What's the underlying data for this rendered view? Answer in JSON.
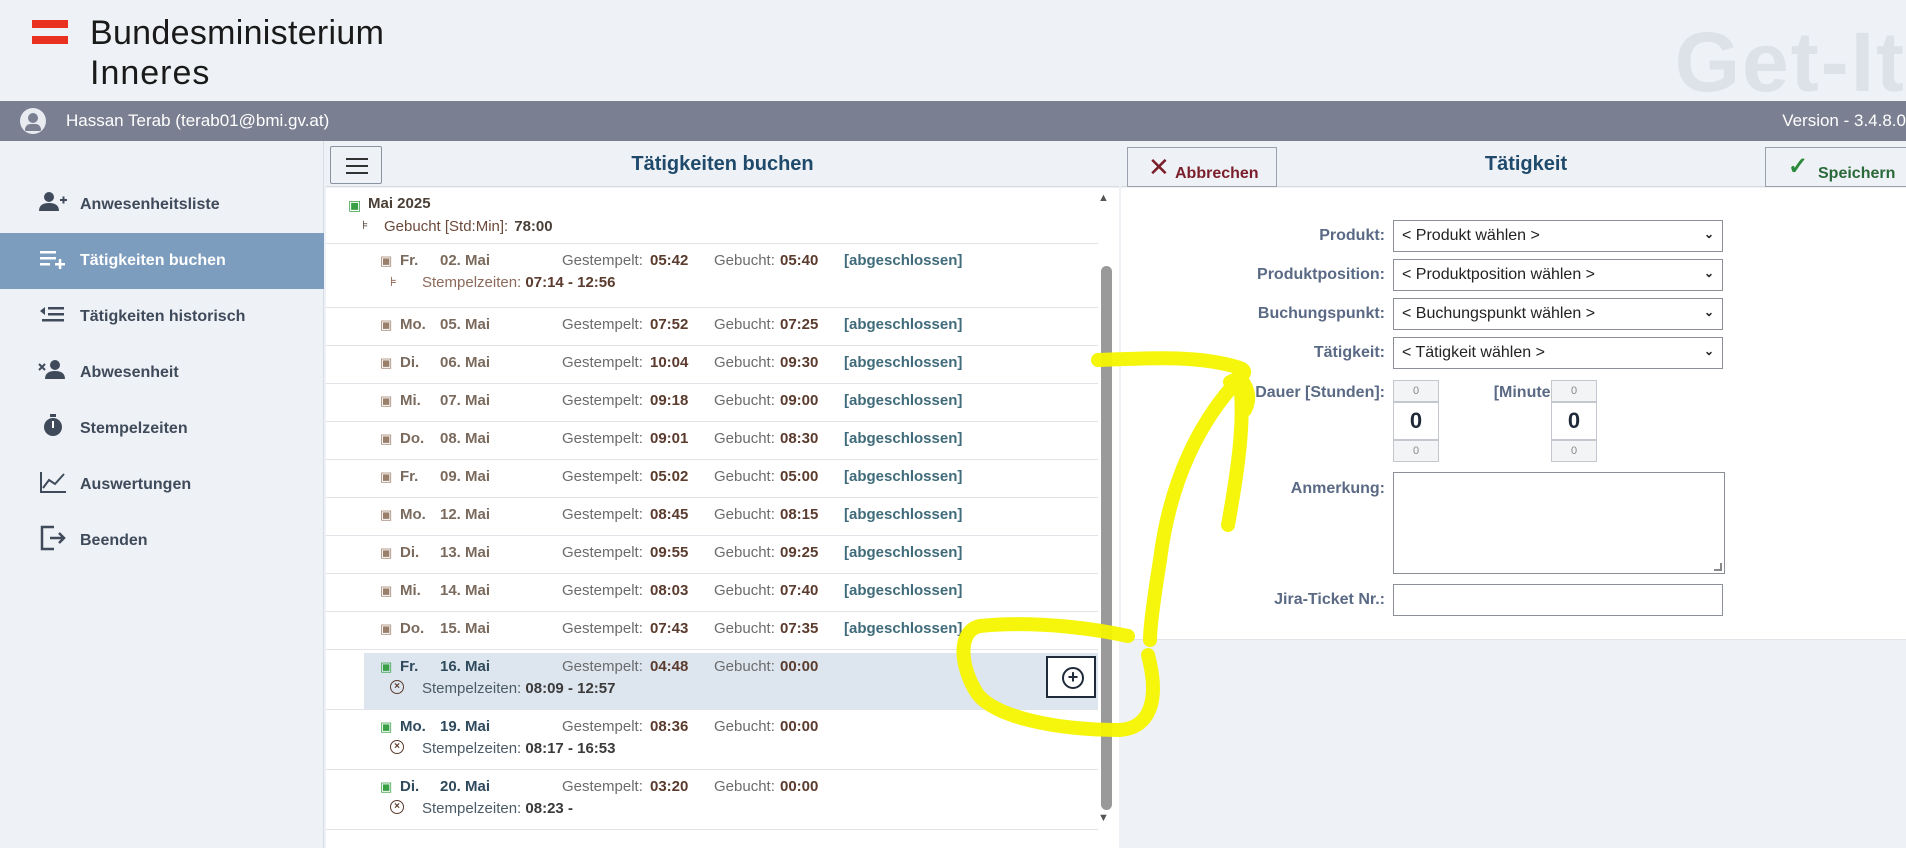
{
  "header": {
    "org_title": "Bundesministerium",
    "org_subtitle": "Inneres",
    "brand": "Get-It"
  },
  "userbar": {
    "user": "Hassan Terab (terab01@bmi.gv.at)",
    "version": "Version - 3.4.8.0"
  },
  "sidebar": {
    "items": [
      {
        "label": "Anwesenheitsliste",
        "icon": "user-add-icon"
      },
      {
        "label": "Tätigkeiten buchen",
        "icon": "list-add-icon"
      },
      {
        "label": "Tätigkeiten historisch",
        "icon": "list-history-icon"
      },
      {
        "label": "Abwesenheit",
        "icon": "user-remove-icon"
      },
      {
        "label": "Stempelzeiten",
        "icon": "stopwatch-icon"
      },
      {
        "label": "Auswertungen",
        "icon": "chart-icon"
      },
      {
        "label": "Beenden",
        "icon": "logout-icon"
      }
    ],
    "active_index": 1
  },
  "booking": {
    "title": "Tätigkeiten buchen",
    "month": {
      "label": "Mai 2025",
      "booked_label": "Gebucht [Std:Min]:",
      "booked_value": "78:00"
    },
    "labels": {
      "stamped": "Gestempelt:",
      "booked": "Gebucht:",
      "stamp_times": "Stempelzeiten:"
    },
    "days": [
      {
        "wd": "Fr.",
        "date": "02. Mai",
        "stamped": "05:42",
        "booked": "05:40",
        "status": "[abgeschlossen]",
        "times": "07:14 - 12:56"
      },
      {
        "wd": "Mo.",
        "date": "05. Mai",
        "stamped": "07:52",
        "booked": "07:25",
        "status": "[abgeschlossen]"
      },
      {
        "wd": "Di.",
        "date": "06. Mai",
        "stamped": "10:04",
        "booked": "09:30",
        "status": "[abgeschlossen]"
      },
      {
        "wd": "Mi.",
        "date": "07. Mai",
        "stamped": "09:18",
        "booked": "09:00",
        "status": "[abgeschlossen]"
      },
      {
        "wd": "Do.",
        "date": "08. Mai",
        "stamped": "09:01",
        "booked": "08:30",
        "status": "[abgeschlossen]"
      },
      {
        "wd": "Fr.",
        "date": "09. Mai",
        "stamped": "05:02",
        "booked": "05:00",
        "status": "[abgeschlossen]"
      },
      {
        "wd": "Mo.",
        "date": "12. Mai",
        "stamped": "08:45",
        "booked": "08:15",
        "status": "[abgeschlossen]"
      },
      {
        "wd": "Di.",
        "date": "13. Mai",
        "stamped": "09:55",
        "booked": "09:25",
        "status": "[abgeschlossen]"
      },
      {
        "wd": "Mi.",
        "date": "14. Mai",
        "stamped": "08:03",
        "booked": "07:40",
        "status": "[abgeschlossen]"
      },
      {
        "wd": "Do.",
        "date": "15. Mai",
        "stamped": "07:43",
        "booked": "07:35",
        "status": "[abgeschlossen]"
      },
      {
        "wd": "Fr.",
        "date": "16. Mai",
        "stamped": "04:48",
        "booked": "00:00",
        "times": "08:09 - 12:57"
      },
      {
        "wd": "Mo.",
        "date": "19. Mai",
        "stamped": "08:36",
        "booked": "00:00",
        "times": "08:17 - 16:53"
      },
      {
        "wd": "Di.",
        "date": "20. Mai",
        "stamped": "03:20",
        "booked": "00:00",
        "times": "08:23 -"
      }
    ]
  },
  "form": {
    "title": "Tätigkeit",
    "cancel_label": "Abbrechen",
    "save_label": "Speichern",
    "produkt_label": "Produkt:",
    "produkt_value": "< Produkt wählen >",
    "position_label": "Produktposition:",
    "position_value": "< Produktposition wählen >",
    "buchungspunkt_label": "Buchungspunkt:",
    "buchungspunkt_value": "< Buchungspunkt wählen >",
    "taetigkeit_label": "Tätigkeit:",
    "taetigkeit_value": "< Tätigkeit wählen >",
    "dauer_label": "Dauer [Stunden]:",
    "minuten_label": "[Minuten]:",
    "hours_prev": "0",
    "hours_value": "0",
    "hours_next": "0",
    "minutes_prev": "0",
    "minutes_value": "0",
    "minutes_next": "0",
    "anmerkung_label": "Anmerkung:",
    "jira_label": "Jira-Ticket Nr.:"
  },
  "colors": {
    "accent": "#7d9dbf",
    "user_bar": "#7a7f91",
    "annotation": "#f5f500"
  }
}
